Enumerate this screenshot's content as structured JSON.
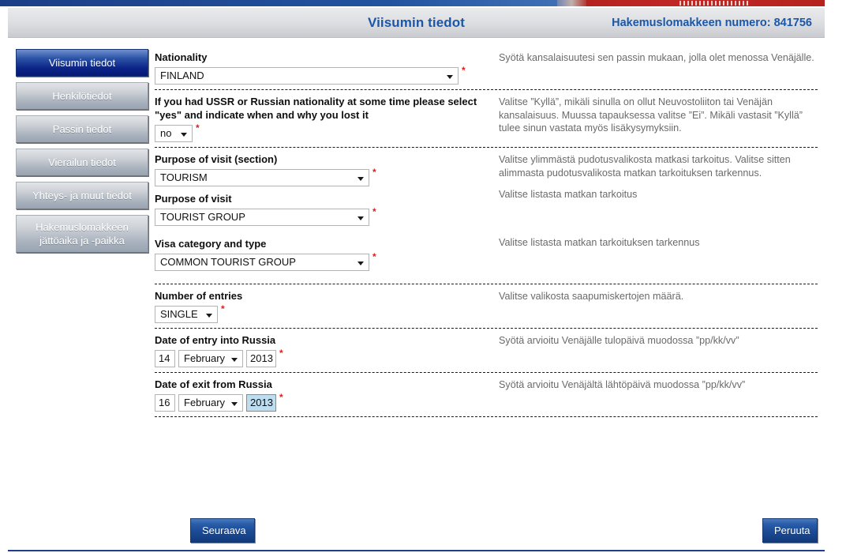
{
  "header": {
    "title": "Viisumin tiedot",
    "application_number_label": "Hakemuslomakkeen numero: 841756"
  },
  "sidebar": {
    "items": [
      {
        "label": "Viisumin tiedot",
        "active": true
      },
      {
        "label": "Henkilötiedot",
        "active": false
      },
      {
        "label": "Passin tiedot",
        "active": false
      },
      {
        "label": "Vierailun tiedot",
        "active": false
      },
      {
        "label": "Yhteys- ja muut tiedot",
        "active": false
      },
      {
        "label": "Hakemuslomakkeen jättöaika ja -paikka",
        "active": false
      }
    ],
    "item_last_line1": "Hakemuslomakkeen",
    "item_last_line2": "jättöaika ja -paikka"
  },
  "form": {
    "required_marker": "*",
    "nationality": {
      "label": "Nationality",
      "value": "FINLAND",
      "help": "Syötä kansalaisuutesi sen passin mukaan, jolla olet menossa Venäjälle."
    },
    "ussr": {
      "label": "If you had USSR or Russian nationality at some time please select \"yes\" and indicate when and why you lost it",
      "value": "no",
      "help": "Valitse ”Kyllä”, mikäli sinulla on ollut Neuvostoliiton tai Venäjän kansalaisuus. Muussa tapauksessa valitse ”Ei”. Mikäli vastasit ”Kyllä” tulee sinun vastata myös lisäkysymyksiin."
    },
    "purpose_section": {
      "label": "Purpose of visit (section)",
      "value": "TOURISM",
      "help": "Valitse ylimmästä pudotusvalikosta matkasi tarkoitus. Valitse sitten alimmasta pudotusvalikosta matkan tarkoituksen tarkennus."
    },
    "purpose": {
      "label": "Purpose of visit",
      "value": "TOURIST GROUP",
      "help": "Valitse listasta matkan tarkoitus"
    },
    "visa_category": {
      "label": "Visa category and type",
      "value": "COMMON TOURIST GROUP",
      "help": "Valitse listasta matkan tarkoituksen tarkennus"
    },
    "entries": {
      "label": "Number of entries",
      "value": "SINGLE",
      "help": "Valitse valikosta saapumiskertojen määrä."
    },
    "date_entry": {
      "label": "Date of entry into Russia",
      "day": "14",
      "month": "February",
      "year": "2013",
      "help": "Syötä arvioitu Venäjälle tulopäivä muodossa ”pp/kk/vv”"
    },
    "date_exit": {
      "label": "Date of exit from Russia",
      "day": "16",
      "month": "February",
      "year": "2013",
      "help": "Syötä arvioitu Venäjältä lähtöpäivä muodossa ”pp/kk/vv”"
    }
  },
  "footer": {
    "next_label": "Seuraava",
    "cancel_label": "Peruuta"
  },
  "colors": {
    "accent_blue": "#1a57a8",
    "active_nav": "#0b2287",
    "required_red": "#e21b1b",
    "help_text": "#6a6a6a",
    "selection_highlight": "#bdddf0"
  }
}
